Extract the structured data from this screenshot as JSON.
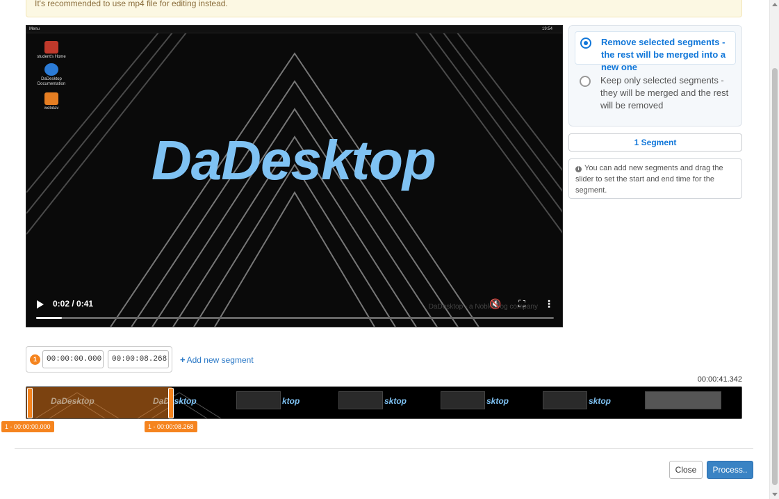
{
  "warning": {
    "text": "It's recommended to use mp4 file for editing instead."
  },
  "video": {
    "desktop_menu": "Menu",
    "desktop_clock": "19:54",
    "desktop_icons": [
      "student's Home",
      "DaDesktop Documentation",
      "webdav"
    ],
    "logo_text": "DaDesktop",
    "time": "0:02 / 0:41",
    "progress_fraction": 0.049,
    "watermark": "DaDesktop - a NobleProg company",
    "icons": {
      "play": "play-icon",
      "mute": "mute-icon",
      "fullscreen": "fullscreen-icon",
      "more": "more-options-icon"
    }
  },
  "options": {
    "remove_label": "Remove selected segments - the rest will be merged into a new one",
    "keep_label": "Keep only selected segments - they will be merged and the rest will be removed",
    "selected": "remove"
  },
  "segments_button": "1 Segment",
  "info_text": "You can add new segments and drag the slider to set the start and end time for the segment.",
  "segment": {
    "number": "1",
    "start": "00:00:00.000",
    "end": "00:00:08.268"
  },
  "add_segment_label": "Add new segment",
  "total_duration": "00:00:41.342",
  "timeline": {
    "thumb_text": "DaDesktop",
    "marker_start": "1 - 00:00:00.000",
    "marker_end": "1 - 00:00:08.268",
    "accent": "#f5841f"
  },
  "buttons": {
    "close": "Close",
    "process": "Process.."
  }
}
